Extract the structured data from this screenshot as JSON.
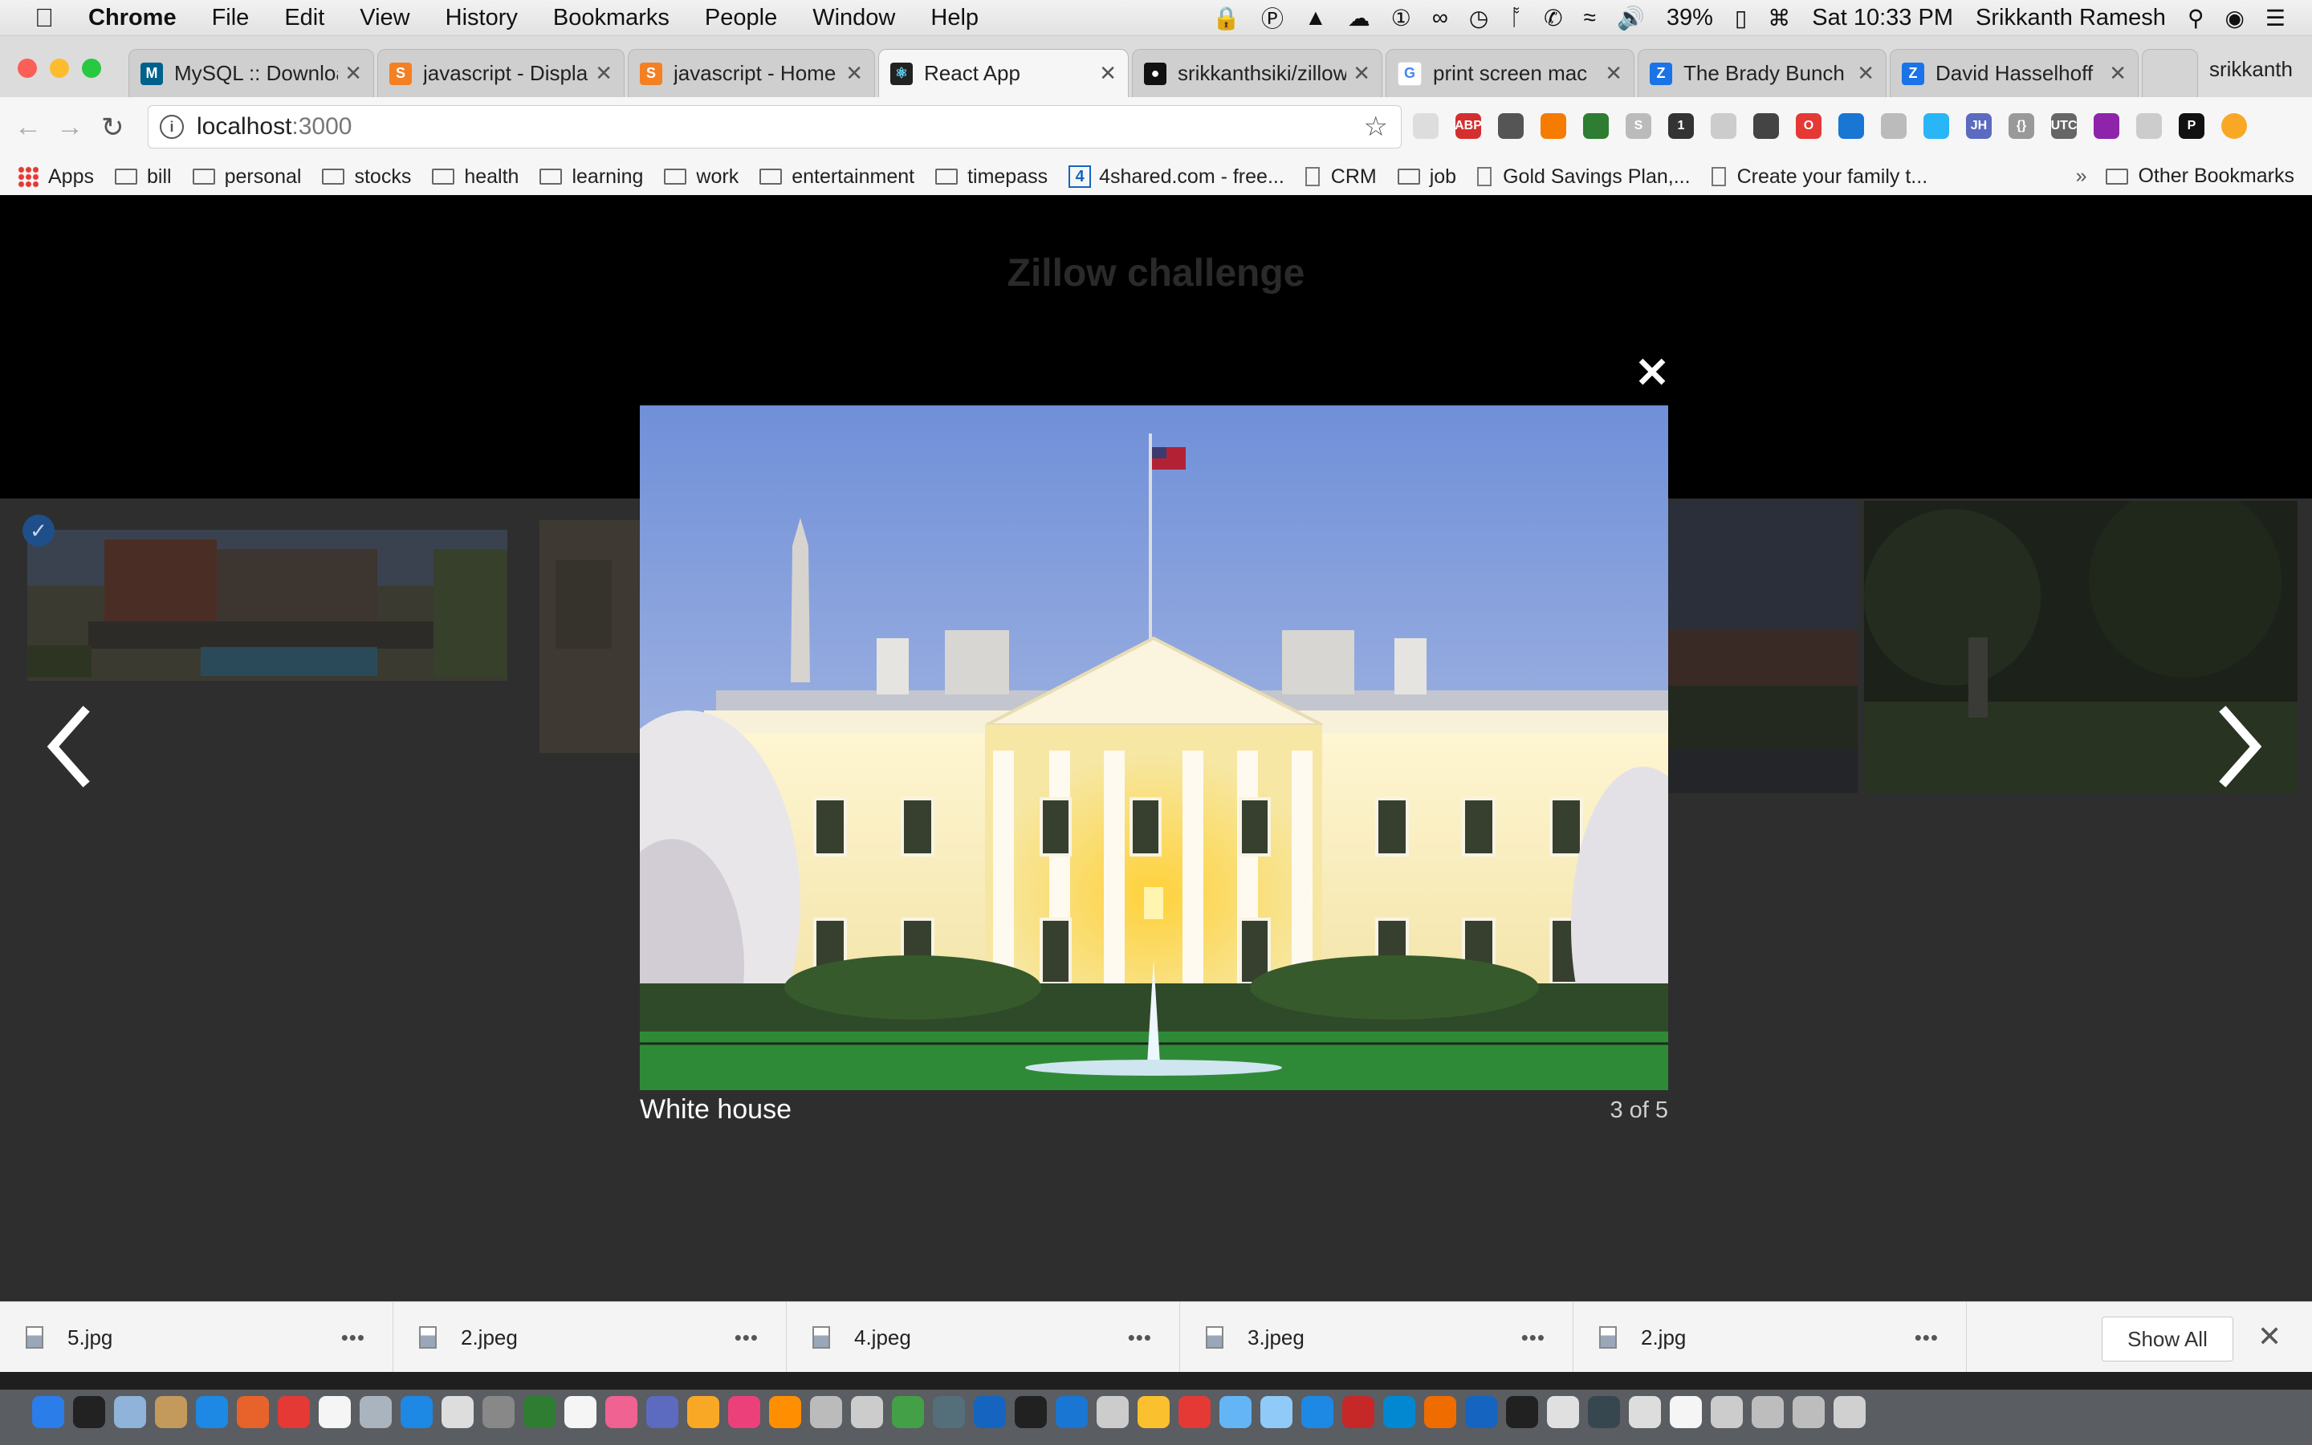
{
  "menubar": {
    "app": "Chrome",
    "items": [
      "File",
      "Edit",
      "View",
      "History",
      "Bookmarks",
      "People",
      "Window",
      "Help"
    ],
    "battery": "39%",
    "datetime": "Sat 10:33 PM",
    "user": "Srikkanth Ramesh"
  },
  "tabs": [
    {
      "title": "MySQL :: Downloa",
      "favicon_color": "#00618a"
    },
    {
      "title": "javascript - Displa",
      "favicon_color": "#f48024"
    },
    {
      "title": "javascript - Home",
      "favicon_color": "#f48024"
    },
    {
      "title": "React App",
      "favicon_color": "#222222"
    },
    {
      "title": "srikkanthsiki/zillow",
      "favicon_color": "#111111"
    },
    {
      "title": "print screen mac",
      "favicon_color": "#4285f4"
    },
    {
      "title": "The Brady Bunch",
      "favicon_color": "#1a73e8"
    },
    {
      "title": "David Hasselhoff",
      "favicon_color": "#1a73e8"
    }
  ],
  "active_tab": 3,
  "profile_name": "srikkanth",
  "omnibox": {
    "host": "localhost",
    "port": ":3000"
  },
  "bookmarks": {
    "items": [
      "bill",
      "personal",
      "stocks",
      "health",
      "learning",
      "work",
      "entertainment",
      "timepass"
    ],
    "apps": "Apps",
    "fourshared": "4shared.com - free...",
    "crm": "CRM",
    "job": "job",
    "gold": "Gold Savings Plan,...",
    "family": "Create your family t...",
    "overflow": "»",
    "other": "Other Bookmarks"
  },
  "page": {
    "title": "Zillow challenge"
  },
  "lightbox": {
    "caption": "White house",
    "counter": "3 of 5",
    "close": "✕"
  },
  "downloads": {
    "files": [
      "5.jpg",
      "2.jpeg",
      "4.jpeg",
      "3.jpeg",
      "2.jpg"
    ],
    "more": "•••",
    "show_all": "Show All",
    "close": "✕"
  },
  "colors": {
    "accent": "#1a73e8",
    "lightbox_backdrop": "#2e2e2e",
    "header": "#000000"
  }
}
